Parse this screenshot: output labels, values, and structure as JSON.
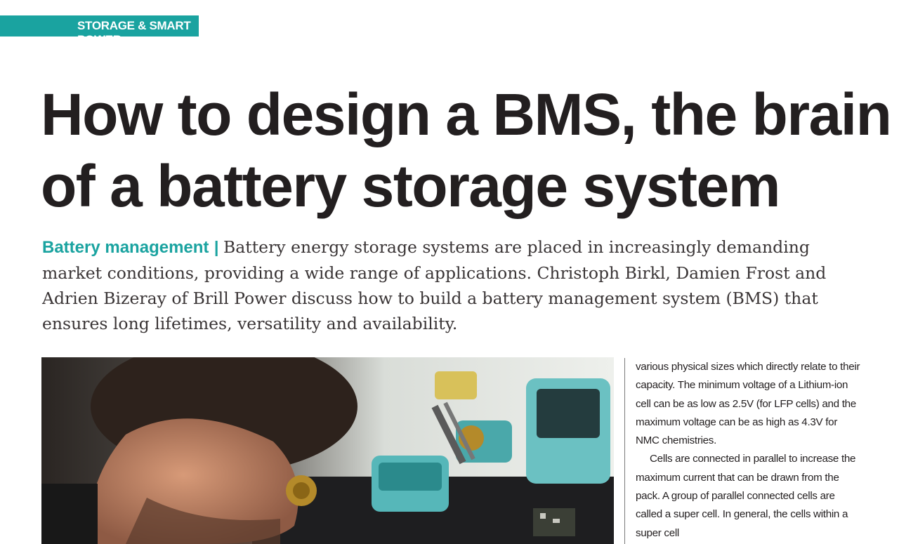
{
  "section_tag": "STORAGE & SMART POWER",
  "headline": {
    "line1": "How to design a BMS, the brain",
    "line2": "of a battery storage system"
  },
  "standfirst": {
    "kicker": "Battery management",
    "separator": "|",
    "text": "Battery energy storage systems are placed in increasingly demanding market conditions, providing a wide range of applications. Christoph Birkl, Damien Frost and Adrien Bizeray of Brill Power discuss how to build a battery management system (BMS) that ensures long lifetimes, versatility and availability."
  },
  "body_column": {
    "paragraph1": "various physical sizes which directly relate to their capacity. The minimum voltage of a Lithium-ion cell can be as low as 2.5V (for LFP cells) and the maximum voltage can be as high as 4.3V for NMC chemistries.",
    "paragraph2": "Cells are connected in parallel to increase the maximum current that can be drawn from the pack. A group of parallel connected cells are called a super cell. In general, the cells within a super cell"
  },
  "colors": {
    "accent": "#1aa3a0",
    "text": "#231f20"
  }
}
